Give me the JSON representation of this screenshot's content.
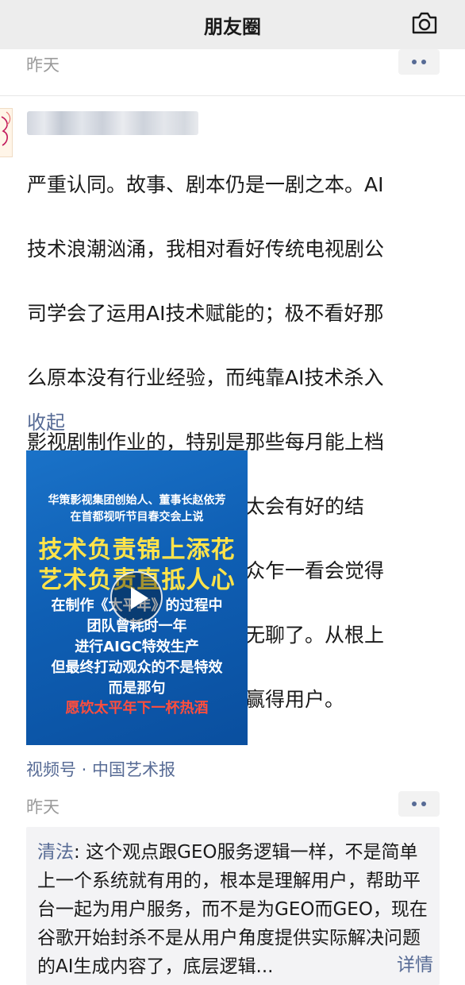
{
  "header": {
    "title": "朋友圈",
    "camera_icon": "camera-icon"
  },
  "previous_post": {
    "time": "昨天"
  },
  "post": {
    "text_lines": [
      "严重认同。故事、剧本仍是一剧之本。AI",
      "技术浪潮汹涌，我相对看好传统电视剧公",
      "司学会了运用AI技术赋能的；极不看好那",
      "么原本没有行业经验，而纯靠AI技术杀入",
      "影视剧制作业的，特别是那些每月能上档",
      "几十部短剧的公司，都不太会有好的结",
      "果。飞来飞去的特效，观众乍一看会觉得",
      "新鲜，时间长了就会觉得无聊了。从根上",
      "看，只有好故事才能真正赢得用户。"
    ],
    "collapse_label": "收起",
    "video": {
      "line1": "华策影视集团创始人、董事长赵依芳",
      "line2": "在首都视听节目春交会上说",
      "line3": "技术负责锦上添花",
      "line4": "艺术负责直抵人心",
      "line5": "在制作《太平年》的过程中",
      "line6": "团队曾耗时一年",
      "line7": "进行AIGC特效生产",
      "line8": "但最终打动观众的不是特效",
      "line9": "而是那句",
      "line10": "愿饮太平年下一杯热酒"
    },
    "source": "视频号 · 中国艺术报",
    "time": "昨天"
  },
  "comment": {
    "user": "清法",
    "separator": ": ",
    "text": "这个观点跟GEO服务逻辑一样，不是简单上一个系统就有用的，根本是理解用户，帮助平台一起为用户服务，而不是为GEO而GEO，现在谷歌开始封杀不是从用户角度提供实际解决问题的AI生成内容了，底层逻辑...",
    "details_label": "详情"
  },
  "colors": {
    "link": "#576b95",
    "video_bg": "#0f5fb4",
    "headline_yellow": "#ffe34a",
    "highlight_red": "#ff4d3d"
  }
}
